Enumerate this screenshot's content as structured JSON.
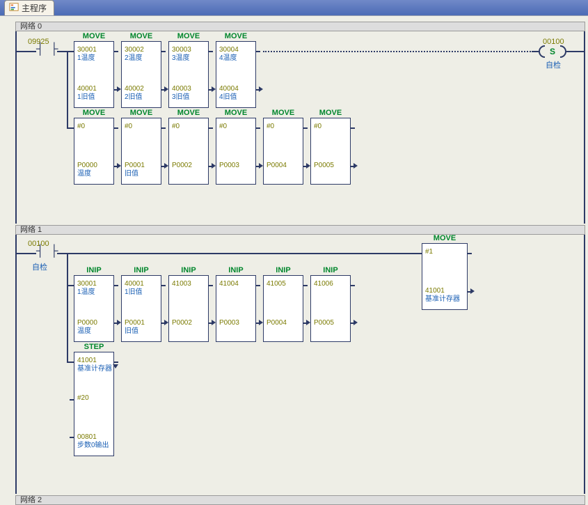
{
  "tab": {
    "title": "主程序"
  },
  "net0": {
    "header": "网络 0",
    "contact": {
      "addr": "09925"
    },
    "coil": {
      "addr": "00100",
      "type": "S",
      "desc": "自检"
    },
    "row1": [
      {
        "title": "MOVE",
        "in_addr": "30001",
        "in_desc": "1温度",
        "out_addr": "40001",
        "out_desc": "1旧值"
      },
      {
        "title": "MOVE",
        "in_addr": "30002",
        "in_desc": "2温度",
        "out_addr": "40002",
        "out_desc": "2旧值"
      },
      {
        "title": "MOVE",
        "in_addr": "30003",
        "in_desc": "3温度",
        "out_addr": "40003",
        "out_desc": "3旧值"
      },
      {
        "title": "MOVE",
        "in_addr": "30004",
        "in_desc": "4温度",
        "out_addr": "40004",
        "out_desc": "4旧值"
      }
    ],
    "row2": [
      {
        "title": "MOVE",
        "in_addr": "#0",
        "in_desc": "",
        "out_addr": "P0000",
        "out_desc": "温度"
      },
      {
        "title": "MOVE",
        "in_addr": "#0",
        "in_desc": "",
        "out_addr": "P0001",
        "out_desc": "旧值"
      },
      {
        "title": "MOVE",
        "in_addr": "#0",
        "in_desc": "",
        "out_addr": "P0002",
        "out_desc": ""
      },
      {
        "title": "MOVE",
        "in_addr": "#0",
        "in_desc": "",
        "out_addr": "P0003",
        "out_desc": ""
      },
      {
        "title": "MOVE",
        "in_addr": "#0",
        "in_desc": "",
        "out_addr": "P0004",
        "out_desc": ""
      },
      {
        "title": "MOVE",
        "in_addr": "#0",
        "in_desc": "",
        "out_addr": "P0005",
        "out_desc": ""
      }
    ]
  },
  "net1": {
    "header": "网络 1",
    "contact": {
      "addr": "00100",
      "desc": "自检"
    },
    "moveblock": {
      "title": "MOVE",
      "in_addr": "#1",
      "in_desc": "",
      "out_addr": "41001",
      "out_desc": "基准计存器"
    },
    "inip": [
      {
        "title": "INIP",
        "in_addr": "30001",
        "in_desc": "1温度",
        "out_addr": "P0000",
        "out_desc": "温度"
      },
      {
        "title": "INIP",
        "in_addr": "40001",
        "in_desc": "1旧值",
        "out_addr": "P0001",
        "out_desc": "旧值"
      },
      {
        "title": "INIP",
        "in_addr": "41003",
        "in_desc": "",
        "out_addr": "P0002",
        "out_desc": ""
      },
      {
        "title": "INIP",
        "in_addr": "41004",
        "in_desc": "",
        "out_addr": "P0003",
        "out_desc": ""
      },
      {
        "title": "INIP",
        "in_addr": "41005",
        "in_desc": "",
        "out_addr": "P0004",
        "out_desc": ""
      },
      {
        "title": "INIP",
        "in_addr": "41006",
        "in_desc": "",
        "out_addr": "P0005",
        "out_desc": ""
      }
    ],
    "step": {
      "title": "STEP",
      "in_addr": "41001",
      "in_desc": "基准计存器",
      "mid_addr": "#20",
      "out_addr": "00801",
      "out_desc": "步数0输出"
    }
  },
  "net2": {
    "header": "网络 2"
  }
}
